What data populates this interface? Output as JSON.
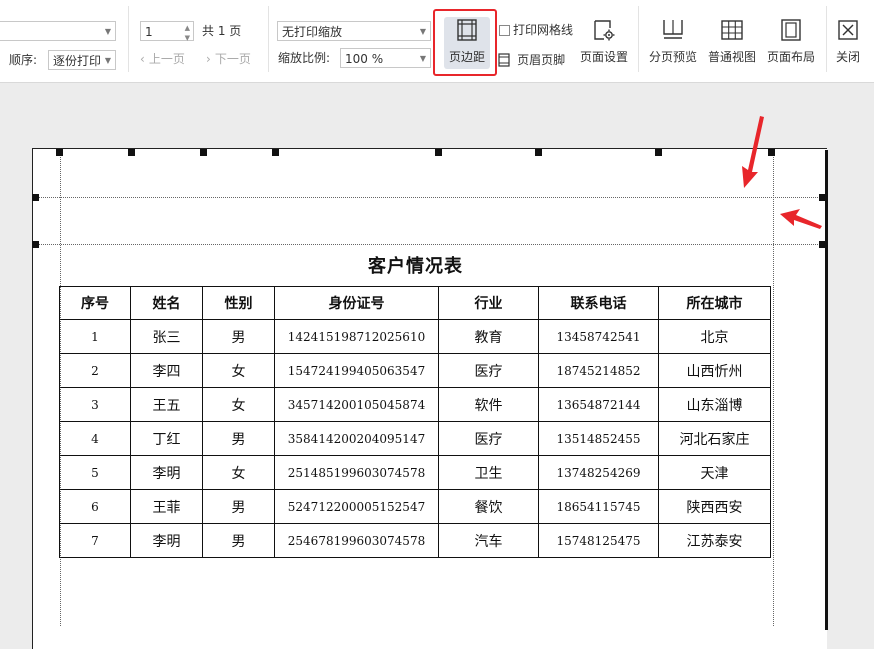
{
  "toolbar": {
    "order_label": "顺序:",
    "order_value": "逐份打印",
    "page_input": "1",
    "page_total": "共 1 页",
    "prev_page": "上一页",
    "next_page": "下一页",
    "scale_mode": "无打印缩放",
    "scale_label": "缩放比例:",
    "scale_value": "100 %",
    "margin_label": "页边距",
    "print_gridlines_label": "打印网格线",
    "header_footer_label": "页眉页脚",
    "page_setup_label": "页面设置",
    "page_break_preview_label": "分页预览",
    "normal_view_label": "普通视图",
    "page_layout_label": "页面布局",
    "close_label": "关闭"
  },
  "sheet": {
    "title": "客户情况表",
    "headers": [
      "序号",
      "姓名",
      "性别",
      "身份证号",
      "行业",
      "联系电话",
      "所在城市"
    ],
    "rows": [
      [
        "1",
        "张三",
        "男",
        "142415198712025610",
        "教育",
        "13458742541",
        "北京"
      ],
      [
        "2",
        "李四",
        "女",
        "154724199405063547",
        "医疗",
        "18745214852",
        "山西忻州"
      ],
      [
        "3",
        "王五",
        "女",
        "345714200105045874",
        "软件",
        "13654872144",
        "山东淄博"
      ],
      [
        "4",
        "丁红",
        "男",
        "358414200204095147",
        "医疗",
        "13514852455",
        "河北石家庄"
      ],
      [
        "5",
        "李明",
        "女",
        "251485199603074578",
        "卫生",
        "13748254269",
        "天津"
      ],
      [
        "6",
        "王菲",
        "男",
        "524712200005152547",
        "餐饮",
        "18654115745",
        "陕西西安"
      ],
      [
        "7",
        "李明",
        "男",
        "254678199603074578",
        "汽车",
        "15748125475",
        "江苏泰安"
      ]
    ]
  },
  "colors": {
    "highlight": "#e8262b",
    "arrow": "#e8262b"
  }
}
